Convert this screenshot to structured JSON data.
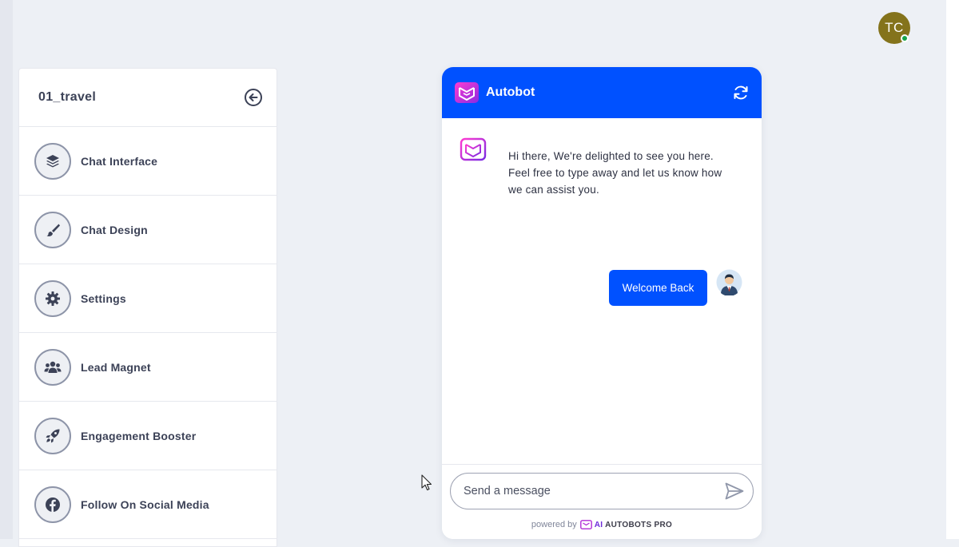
{
  "user": {
    "initials": "TC"
  },
  "sidebar": {
    "title": "01_travel",
    "back_icon": "arrow-left-circle-icon",
    "items": [
      {
        "label": "Chat Interface",
        "icon": "layers-icon"
      },
      {
        "label": "Chat Design",
        "icon": "paintbrush-icon"
      },
      {
        "label": "Settings",
        "icon": "gear-icon"
      },
      {
        "label": "Lead Magnet",
        "icon": "users-icon"
      },
      {
        "label": "Engagement Booster",
        "icon": "rocket-icon"
      },
      {
        "label": "Follow On Social Media",
        "icon": "facebook-icon"
      }
    ]
  },
  "chat": {
    "title": "Autobot",
    "bot_message": "Hi there, We're delighted to see you here. Feel free to type away and let us know how we can assist you.",
    "user_message": "Welcome Back",
    "input_placeholder": "Send a message",
    "powered_by": "powered by",
    "brand_ai": "AI",
    "brand_rest": "AUTOBOTS PRO",
    "header_color": "#0051ff"
  }
}
